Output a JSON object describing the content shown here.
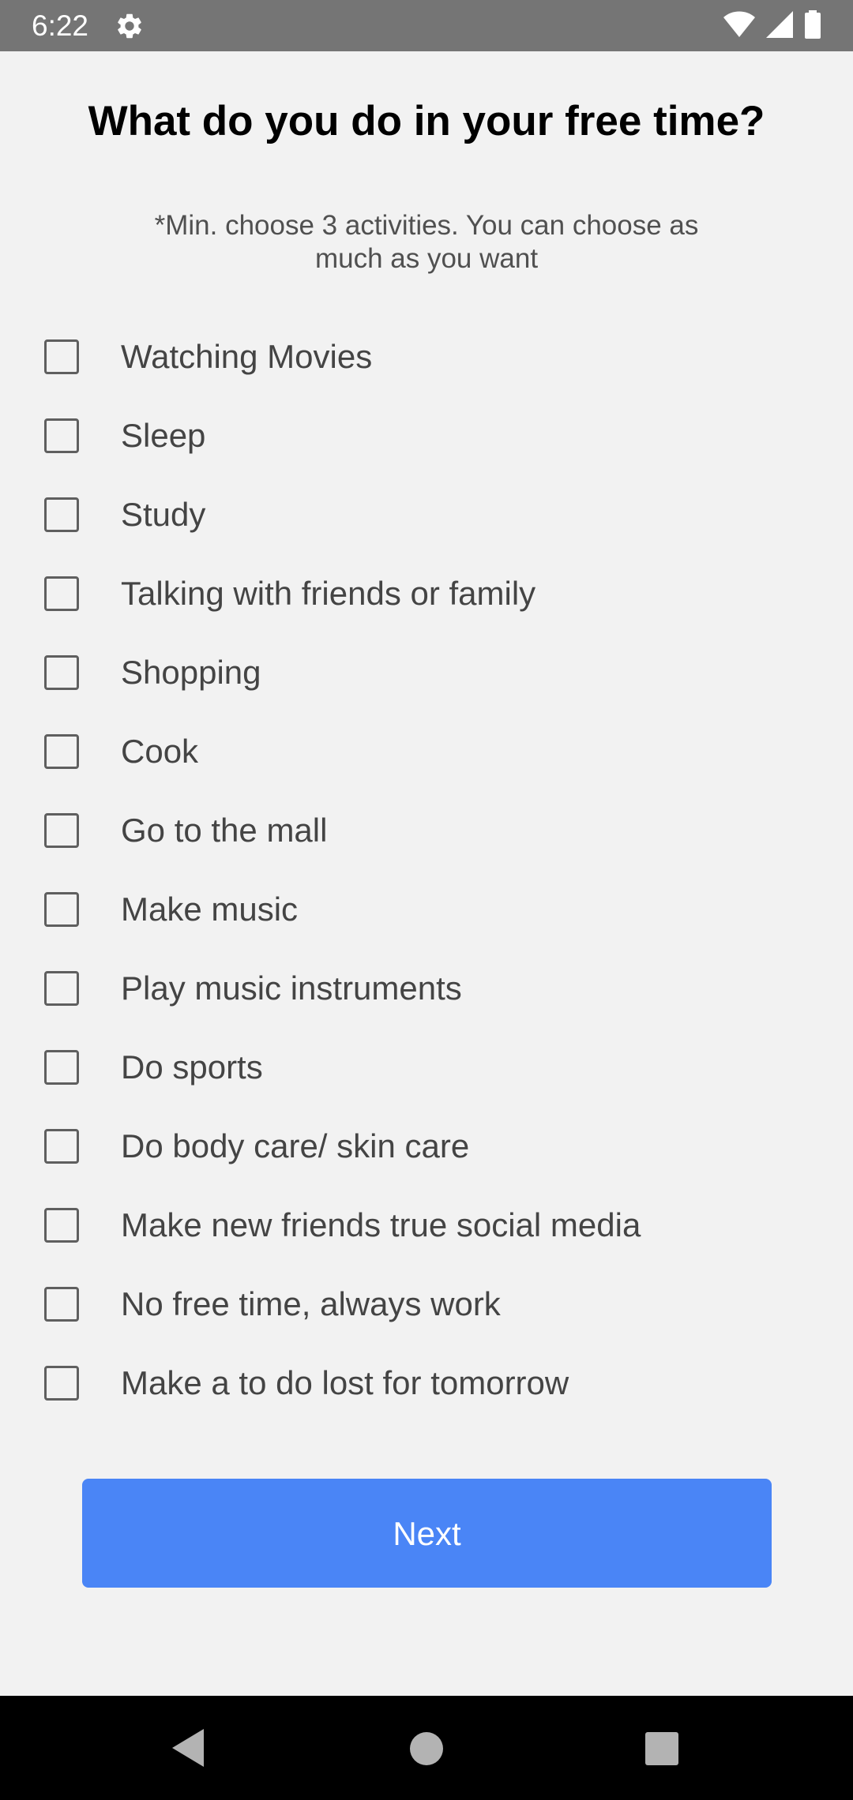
{
  "status_bar": {
    "time": "6:22",
    "icons": [
      "gear-icon",
      "wifi-icon",
      "signal-icon",
      "battery-icon"
    ]
  },
  "title": "What do you do in your free time?",
  "subtitle": "*Min. choose 3 activities. You can choose as much as you want",
  "options": [
    {
      "label": "Watching Movies",
      "checked": false
    },
    {
      "label": "Sleep",
      "checked": false
    },
    {
      "label": "Study",
      "checked": false
    },
    {
      "label": "Talking with friends or family",
      "checked": false
    },
    {
      "label": "Shopping",
      "checked": false
    },
    {
      "label": "Cook",
      "checked": false
    },
    {
      "label": "Go to the mall",
      "checked": false
    },
    {
      "label": "Make music",
      "checked": false
    },
    {
      "label": "Play music instruments",
      "checked": false
    },
    {
      "label": "Do sports",
      "checked": false
    },
    {
      "label": "Do body care/ skin care",
      "checked": false
    },
    {
      "label": "Make new friends true social media",
      "checked": false
    },
    {
      "label": "No free time, always work",
      "checked": false
    },
    {
      "label": "Make a to do lost for tomorrow",
      "checked": false
    }
  ],
  "next_button": {
    "label": "Next"
  },
  "nav_bar": {
    "icons": [
      "back-icon",
      "home-icon",
      "recent-apps-icon"
    ]
  },
  "colors": {
    "accent": "#4a85f6",
    "status_bar": "#757575",
    "background": "#f2f2f2",
    "nav_bar": "#000000"
  }
}
